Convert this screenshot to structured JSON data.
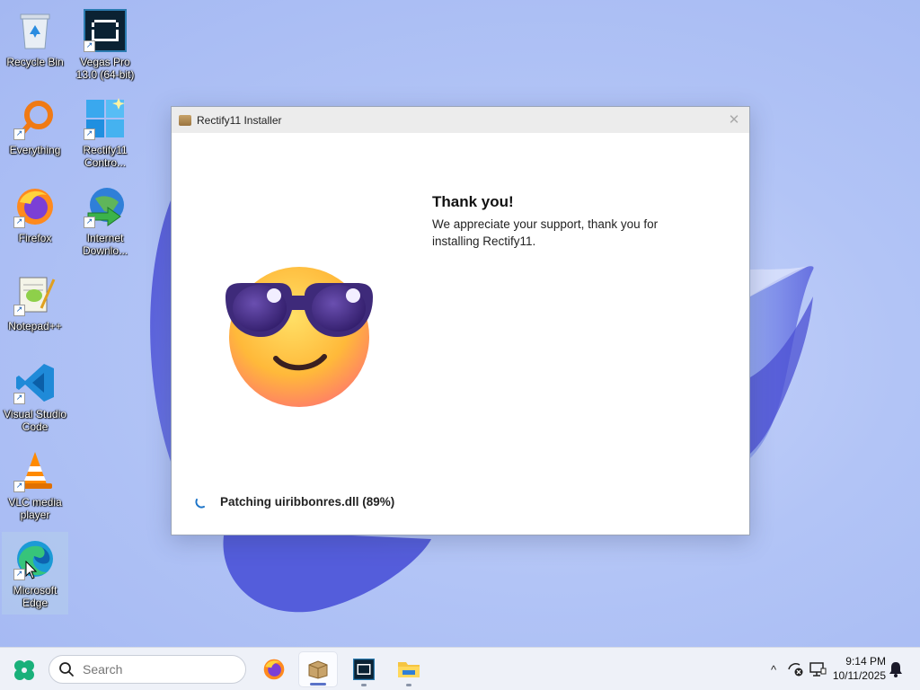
{
  "desktop": {
    "icons": [
      {
        "label": "Recycle Bin",
        "icon": "recycle-bin-icon"
      },
      {
        "label": "Vegas Pro\n13.0 (64-bit)",
        "icon": "vegas-pro-icon"
      },
      {
        "label": "Everything",
        "icon": "everything-search-icon"
      },
      {
        "label": "Rectify11\nContro...",
        "icon": "rectify11-control-panel-icon"
      },
      {
        "label": "Firefox",
        "icon": "firefox-icon"
      },
      {
        "label": "Internet\nDownlo...",
        "icon": "internet-download-manager-icon"
      },
      {
        "label": "Notepad++",
        "icon": "notepad-plus-plus-icon"
      },
      {
        "label": "Visual Studio\nCode",
        "icon": "vscode-icon"
      },
      {
        "label": "VLC media\nplayer",
        "icon": "vlc-icon"
      },
      {
        "label": "Microsoft\nEdge",
        "icon": "edge-icon"
      }
    ]
  },
  "window": {
    "title": "Rectify11 Installer",
    "close_glyph": "✕",
    "heading": "Thank you!",
    "message": "We appreciate your support, thank you for installing Rectify11.",
    "status": "Patching uiribbonres.dll (89%)",
    "progress_percent": 89
  },
  "taskbar": {
    "search_placeholder": "Search",
    "apps": [
      "Firefox",
      "Rectify11 Installer",
      "Vegas Pro",
      "File Explorer"
    ],
    "active_app": "Rectify11 Installer",
    "tray_chevron": "^",
    "time": "9:14 PM",
    "date": "10/11/2025"
  },
  "colors": {
    "accent": "#1a73c8",
    "wallpaper": "#a9bff5",
    "taskbar": "#eef1f8"
  }
}
